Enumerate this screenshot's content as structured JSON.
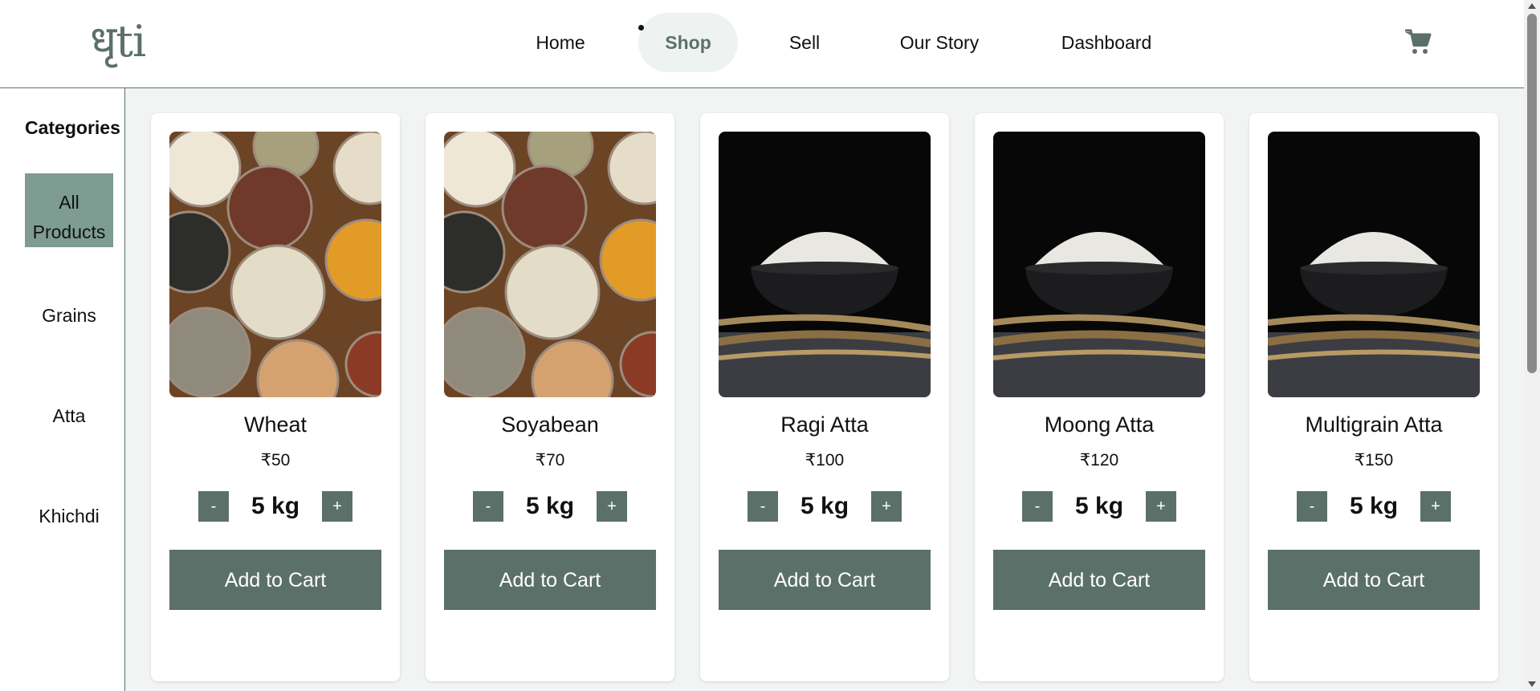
{
  "header": {
    "logo": "धृti",
    "nav": [
      "Home",
      "Shop",
      "Sell",
      "Our Story",
      "Dashboard"
    ],
    "active_nav": "Shop",
    "cart_icon": "shopping-cart-icon"
  },
  "sidebar": {
    "title": "Categories",
    "items": [
      "All Products",
      "Grains",
      "Atta",
      "Khichdi"
    ],
    "active": "All Products"
  },
  "products": [
    {
      "name": "Wheat",
      "price": "₹50",
      "qty": "5 kg",
      "image": "assorted-grains-bowls",
      "add_label": "Add to Cart"
    },
    {
      "name": "Soyabean",
      "price": "₹70",
      "qty": "5 kg",
      "image": "assorted-grains-bowls",
      "add_label": "Add to Cart"
    },
    {
      "name": "Ragi Atta",
      "price": "₹100",
      "qty": "5 kg",
      "image": "flour-bowl-wheat",
      "add_label": "Add to Cart"
    },
    {
      "name": "Moong Atta",
      "price": "₹120",
      "qty": "5 kg",
      "image": "flour-bowl-wheat",
      "add_label": "Add to Cart"
    },
    {
      "name": "Multigrain Atta",
      "price": "₹150",
      "qty": "5 kg",
      "image": "flour-bowl-wheat",
      "add_label": "Add to Cart"
    }
  ],
  "qty_minus": "-",
  "qty_plus": "+",
  "colors": {
    "accent": "#5b7069",
    "active_category": "#7e9c91",
    "nav_active_bg": "#eef3f1",
    "main_bg": "#f1f4f3"
  }
}
